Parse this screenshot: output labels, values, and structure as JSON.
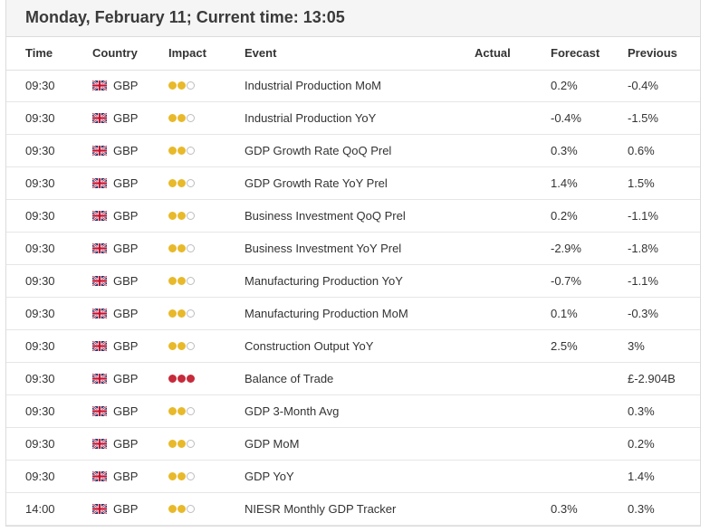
{
  "header": {
    "title": "Monday, February 11; Current time: 13:05"
  },
  "columns": {
    "time": "Time",
    "country": "Country",
    "impact": "Impact",
    "event": "Event",
    "actual": "Actual",
    "forecast": "Forecast",
    "previous": "Previous"
  },
  "colors": {
    "dot_medium": "#e8b92a",
    "dot_high": "#c62b3b",
    "dot_off_border": "#bdbdbd"
  },
  "rows": [
    {
      "time": "09:30",
      "country": "GBP",
      "flag": "uk-flag-icon",
      "impact": 2,
      "event": "Industrial Production MoM",
      "actual": "",
      "forecast": "0.2%",
      "previous": "-0.4%"
    },
    {
      "time": "09:30",
      "country": "GBP",
      "flag": "uk-flag-icon",
      "impact": 2,
      "event": "Industrial Production YoY",
      "actual": "",
      "forecast": "-0.4%",
      "previous": "-1.5%"
    },
    {
      "time": "09:30",
      "country": "GBP",
      "flag": "uk-flag-icon",
      "impact": 2,
      "event": "GDP Growth Rate QoQ Prel",
      "actual": "",
      "forecast": "0.3%",
      "previous": "0.6%"
    },
    {
      "time": "09:30",
      "country": "GBP",
      "flag": "uk-flag-icon",
      "impact": 2,
      "event": "GDP Growth Rate YoY Prel",
      "actual": "",
      "forecast": "1.4%",
      "previous": "1.5%"
    },
    {
      "time": "09:30",
      "country": "GBP",
      "flag": "uk-flag-icon",
      "impact": 2,
      "event": "Business Investment QoQ Prel",
      "actual": "",
      "forecast": "0.2%",
      "previous": "-1.1%"
    },
    {
      "time": "09:30",
      "country": "GBP",
      "flag": "uk-flag-icon",
      "impact": 2,
      "event": "Business Investment YoY Prel",
      "actual": "",
      "forecast": "-2.9%",
      "previous": "-1.8%"
    },
    {
      "time": "09:30",
      "country": "GBP",
      "flag": "uk-flag-icon",
      "impact": 2,
      "event": "Manufacturing Production YoY",
      "actual": "",
      "forecast": "-0.7%",
      "previous": "-1.1%"
    },
    {
      "time": "09:30",
      "country": "GBP",
      "flag": "uk-flag-icon",
      "impact": 2,
      "event": "Manufacturing Production MoM",
      "actual": "",
      "forecast": "0.1%",
      "previous": "-0.3%"
    },
    {
      "time": "09:30",
      "country": "GBP",
      "flag": "uk-flag-icon",
      "impact": 2,
      "event": "Construction Output YoY",
      "actual": "",
      "forecast": "2.5%",
      "previous": "3%"
    },
    {
      "time": "09:30",
      "country": "GBP",
      "flag": "uk-flag-icon",
      "impact": 3,
      "event": "Balance of Trade",
      "actual": "",
      "forecast": "",
      "previous": "£-2.904B"
    },
    {
      "time": "09:30",
      "country": "GBP",
      "flag": "uk-flag-icon",
      "impact": 2,
      "event": "GDP 3-Month Avg",
      "actual": "",
      "forecast": "",
      "previous": "0.3%"
    },
    {
      "time": "09:30",
      "country": "GBP",
      "flag": "uk-flag-icon",
      "impact": 2,
      "event": "GDP MoM",
      "actual": "",
      "forecast": "",
      "previous": "0.2%"
    },
    {
      "time": "09:30",
      "country": "GBP",
      "flag": "uk-flag-icon",
      "impact": 2,
      "event": "GDP YoY",
      "actual": "",
      "forecast": "",
      "previous": "1.4%"
    },
    {
      "time": "14:00",
      "country": "GBP",
      "flag": "uk-flag-icon",
      "impact": 2,
      "event": "NIESR Monthly GDP Tracker",
      "actual": "",
      "forecast": "0.3%",
      "previous": "0.3%"
    }
  ]
}
